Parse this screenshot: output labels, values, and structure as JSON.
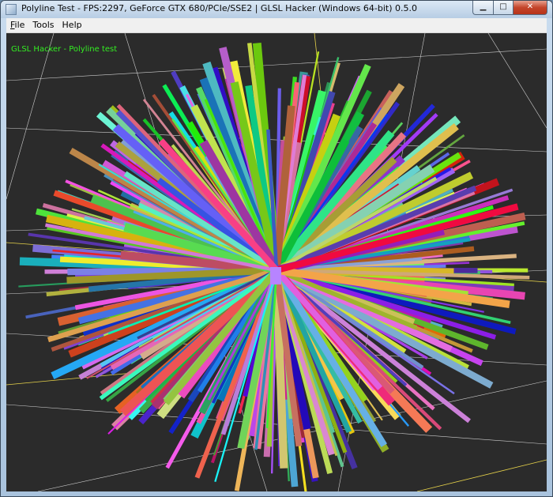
{
  "window": {
    "title": "Polyline Test - FPS:2297, GeForce GTX 680/PCIe/SSE2 | GLSL Hacker (Windows 64-bit) 0.5.0",
    "minimize_glyph": "▁",
    "maximize_glyph": "□",
    "close_glyph": "✕"
  },
  "menu": {
    "file": {
      "accel": "F",
      "rest": "ile"
    },
    "tools": "Tools",
    "help": "Help"
  },
  "viewport": {
    "overlay_label": "GLSL Hacker - Polyline test",
    "background_color": "#2b2b2b",
    "overlay_color": "#33ee22",
    "grid_color": "#cfcfcf",
    "axis_color": "#e6d24a"
  }
}
